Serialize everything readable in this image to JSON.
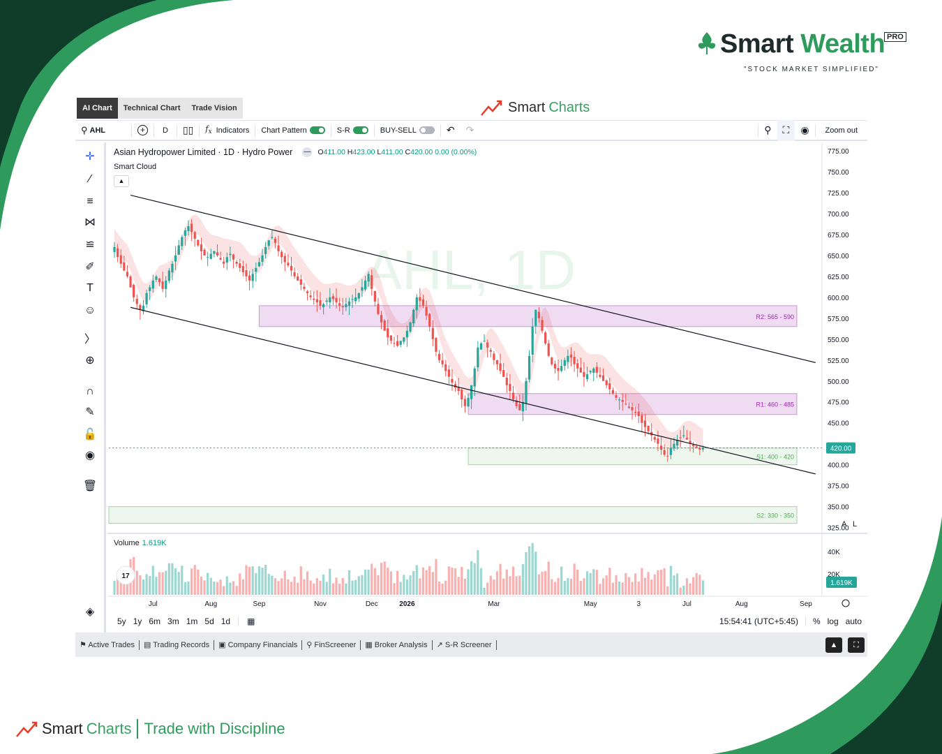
{
  "brand": {
    "name_part1": "Smart",
    "name_part2": "Wealth",
    "pro": "PRO",
    "tagline": "\"STOCK MARKET SIMPLIFIED\""
  },
  "tabs": [
    "AI Chart",
    "Technical Chart",
    "Trade Vision"
  ],
  "app_title": {
    "part1": "Smart",
    "part2": "Charts"
  },
  "toolbar": {
    "symbol": "AHL",
    "interval": "D",
    "indicators": "Indicators",
    "chart_pattern": "Chart Pattern",
    "sr": "S-R",
    "buysell": "BUY-SELL",
    "zoom_out": "Zoom out"
  },
  "legend": {
    "title": "Asian Hydropower Limited · 1D · Hydro Power",
    "open_label": "O",
    "open": "411.00",
    "high_label": "H",
    "high": "423.00",
    "low_label": "L",
    "low": "411.00",
    "close_label": "C",
    "close": "420.00 0.00 (0.00%)",
    "indicator": "Smart Cloud",
    "watermark": "AHL, 1D"
  },
  "volume_legend": {
    "label": "Volume",
    "value": "1.619K"
  },
  "bottombar": {
    "ranges": [
      "5y",
      "1y",
      "6m",
      "3m",
      "1m",
      "5d",
      "1d"
    ],
    "time": "15:54:41 (UTC+5:45)",
    "percent": "%",
    "log": "log",
    "auto": "auto"
  },
  "footer": [
    "Active Trades",
    "Trading Records",
    "Company Financials",
    "FinScreener",
    "Broker Analysis",
    "S-R Screener"
  ],
  "footer_brand": {
    "part1": "Smart",
    "part2": "Charts",
    "tagline": "Trade with Discipline"
  },
  "colors": {
    "up": "#26a69a",
    "down": "#ef5350",
    "resistance": "#9c27b0",
    "support": "#4caf50",
    "brand_green": "#2e9a5c",
    "dark_green": "#0f3d2a"
  },
  "chart_data": {
    "type": "candlestick",
    "title": "Asian Hydropower Limited · 1D · Hydro Power",
    "y_ticks": [
      775,
      750,
      725,
      700,
      675,
      650,
      625,
      600,
      575,
      550,
      525,
      500,
      475,
      450,
      400,
      375,
      350,
      325
    ],
    "y_tick_labels": [
      "775.00",
      "750.00",
      "725.00",
      "700.00",
      "675.00",
      "650.00",
      "625.00",
      "600.00",
      "575.00",
      "550.00",
      "525.00",
      "500.00",
      "475.00",
      "450.00",
      "400.00",
      "375.00",
      "350.00",
      "325.00"
    ],
    "ylim": [
      318,
      785
    ],
    "last_price_label": "420.00",
    "last_price": 420,
    "x_labels": [
      "Jul",
      "Aug",
      "Sep",
      "Nov",
      "Dec",
      "2026",
      "Mar",
      "May",
      "3",
      "Jul",
      "Aug",
      "Sep"
    ],
    "x_label_index": [
      12,
      30,
      45,
      64,
      80,
      91,
      118,
      148,
      163,
      178,
      195,
      215
    ],
    "zones": [
      {
        "label": "R2: 565 - 590",
        "low": 565,
        "high": 590,
        "kind": "resistance",
        "start_index": 45
      },
      {
        "label": "R1: 460 - 485",
        "low": 460,
        "high": 485,
        "kind": "resistance",
        "start_index": 110
      },
      {
        "label": "S1: 400 - 420",
        "low": 400,
        "high": 420,
        "kind": "support",
        "start_index": 110
      },
      {
        "label": "S2: 330 - 350",
        "low": 330,
        "high": 350,
        "kind": "support",
        "start_index": 0
      }
    ],
    "channel": {
      "upper": {
        "start_index": 5,
        "start": 722,
        "end_index": 218,
        "end": 522
      },
      "lower": {
        "start_index": 5,
        "start": 588,
        "end_index": 218,
        "end": 389
      }
    },
    "closes": [
      660,
      648,
      640,
      632,
      625,
      612,
      600,
      592,
      585,
      590,
      605,
      612,
      620,
      625,
      618,
      610,
      620,
      632,
      640,
      650,
      662,
      672,
      680,
      685,
      678,
      670,
      662,
      655,
      650,
      648,
      652,
      655,
      650,
      645,
      640,
      648,
      652,
      645,
      640,
      635,
      630,
      625,
      620,
      628,
      635,
      642,
      650,
      660,
      668,
      672,
      665,
      655,
      648,
      642,
      638,
      632,
      625,
      620,
      615,
      610,
      605,
      600,
      597,
      594,
      590,
      592,
      596,
      600,
      598,
      594,
      590,
      588,
      592,
      595,
      598,
      600,
      605,
      612,
      620,
      628,
      610,
      595,
      580,
      570,
      560,
      552,
      548,
      545,
      542,
      548,
      552,
      560,
      570,
      585,
      600,
      596,
      590,
      578,
      565,
      550,
      535,
      525,
      520,
      512,
      505,
      498,
      492,
      488,
      478,
      470,
      480,
      495,
      515,
      540,
      545,
      548,
      540,
      535,
      525,
      520,
      512,
      505,
      495,
      488,
      478,
      470,
      465,
      475,
      500,
      530,
      565,
      585,
      575,
      560,
      545,
      530,
      520,
      515,
      512,
      518,
      525,
      530,
      528,
      520,
      515,
      510,
      505,
      508,
      512,
      515,
      510,
      505,
      500,
      495,
      490,
      485,
      480,
      478,
      475,
      472,
      468,
      465,
      462,
      458,
      450,
      445,
      440,
      435,
      430,
      425,
      418,
      412,
      410,
      420,
      425,
      430,
      432,
      435,
      430,
      425,
      422,
      420,
      418,
      420
    ],
    "volume_max_label": "40K",
    "volume_ticks": [
      "40K",
      "20K"
    ],
    "volume_last": "1.619K"
  }
}
